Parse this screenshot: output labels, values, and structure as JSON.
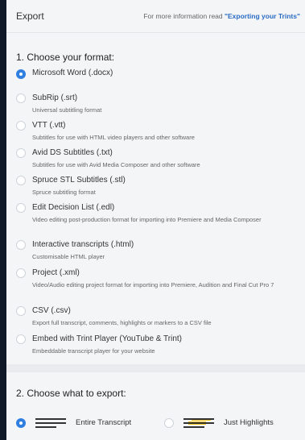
{
  "header": {
    "title": "Export",
    "info_prefix": "For more information read ",
    "info_link": "\"Exporting your Trints\""
  },
  "section1": {
    "title": "1. Choose your format:",
    "options": [
      {
        "label": "Microsoft Word (.docx)",
        "desc": "",
        "selected": true
      },
      {
        "label": "SubRip (.srt)",
        "desc": "Universal subtitling format",
        "selected": false
      },
      {
        "label": "VTT (.vtt)",
        "desc": "Subtitles for use with HTML video players and other software",
        "selected": false
      },
      {
        "label": "Avid DS Subtitles (.txt)",
        "desc": "Subtitles for use with Avid Media Composer and other software",
        "selected": false
      },
      {
        "label": "Spruce STL Subtitles (.stl)",
        "desc": "Spruce subtitling format",
        "selected": false
      },
      {
        "label": "Edit Decision List (.edl)",
        "desc": "Video editing post-production format for importing into Premiere and Media Composer",
        "selected": false
      },
      {
        "label": "Interactive transcripts (.html)",
        "desc": "Customisable HTML player",
        "selected": false
      },
      {
        "label": "Project (.xml)",
        "desc": "Video/Audio editing project format for importing into Premiere, Audition and Final Cut Pro 7",
        "selected": false
      },
      {
        "label": "CSV (.csv)",
        "desc": "Export full transcript, comments, highlights or markers to a CSV file",
        "selected": false
      },
      {
        "label": "Embed with Trint Player (YouTube & Trint)",
        "desc": "Embeddable transcript player for your website",
        "selected": false
      }
    ]
  },
  "section2": {
    "title": "2. Choose what to export:",
    "options": [
      {
        "label": "Entire Transcript",
        "icon": "transcript-lines-icon",
        "selected": true
      },
      {
        "label": "Just Highlights",
        "icon": "highlight-lines-icon",
        "selected": false
      }
    ]
  },
  "colors": {
    "accent": "#2f7fe0",
    "highlight": "#f0c419",
    "background": "#0f1826"
  }
}
